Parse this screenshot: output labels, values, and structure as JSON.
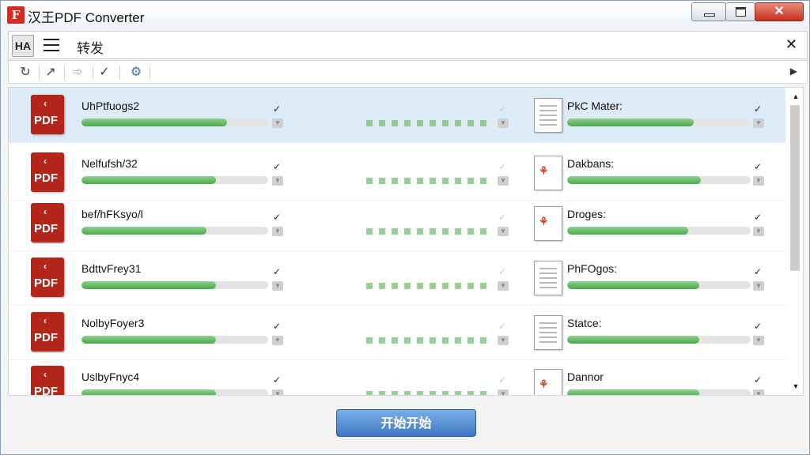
{
  "window": {
    "title": "汉王PDF Converter",
    "logo_text": "F",
    "close_glyph": "✕"
  },
  "tabbar": {
    "tab_icon_label": "HA",
    "tab_label": "转发",
    "close_glyph": "✕"
  },
  "toolbar": {
    "icons": [
      "refresh-icon",
      "edit-icon",
      "forward-icon",
      "check-arrow-icon",
      "settings-globe-icon"
    ],
    "glyphs": [
      "↻",
      "↗",
      "➾",
      "✓",
      "⚙"
    ],
    "right_glyph": "▶"
  },
  "rows": [
    {
      "file": "UhPtfuogs2",
      "progress": 0.78,
      "output": "PkC Mater:",
      "out_progress": 0.69,
      "dashes": 10
    },
    {
      "file": "Nelfufsh/32",
      "progress": 0.72,
      "output": "Dakbans:",
      "out_progress": 0.73,
      "dashes": 10
    },
    {
      "file": "bef/hFKsyo/l",
      "progress": 0.67,
      "output": "Droges:",
      "out_progress": 0.66,
      "dashes": 10
    },
    {
      "file": "BdttvFrey31",
      "progress": 0.72,
      "output": "PhFOgos:",
      "out_progress": 0.72,
      "dashes": 10
    },
    {
      "file": "NolbyFoyer3",
      "progress": 0.72,
      "output": "Statce:",
      "out_progress": 0.72,
      "dashes": 10
    },
    {
      "file": "UslbyFnyc4",
      "progress": 0.72,
      "output": "Dannor",
      "out_progress": 0.72,
      "dashes": 10
    }
  ],
  "pdf_icon_text": "PDF",
  "footer": {
    "start_label": "开始开始"
  },
  "colors": {
    "selected_row": "#ddeaf8",
    "progress_fill": "#49a94a",
    "pdf_red": "#b4261a",
    "start_button": "#3e78c3"
  }
}
